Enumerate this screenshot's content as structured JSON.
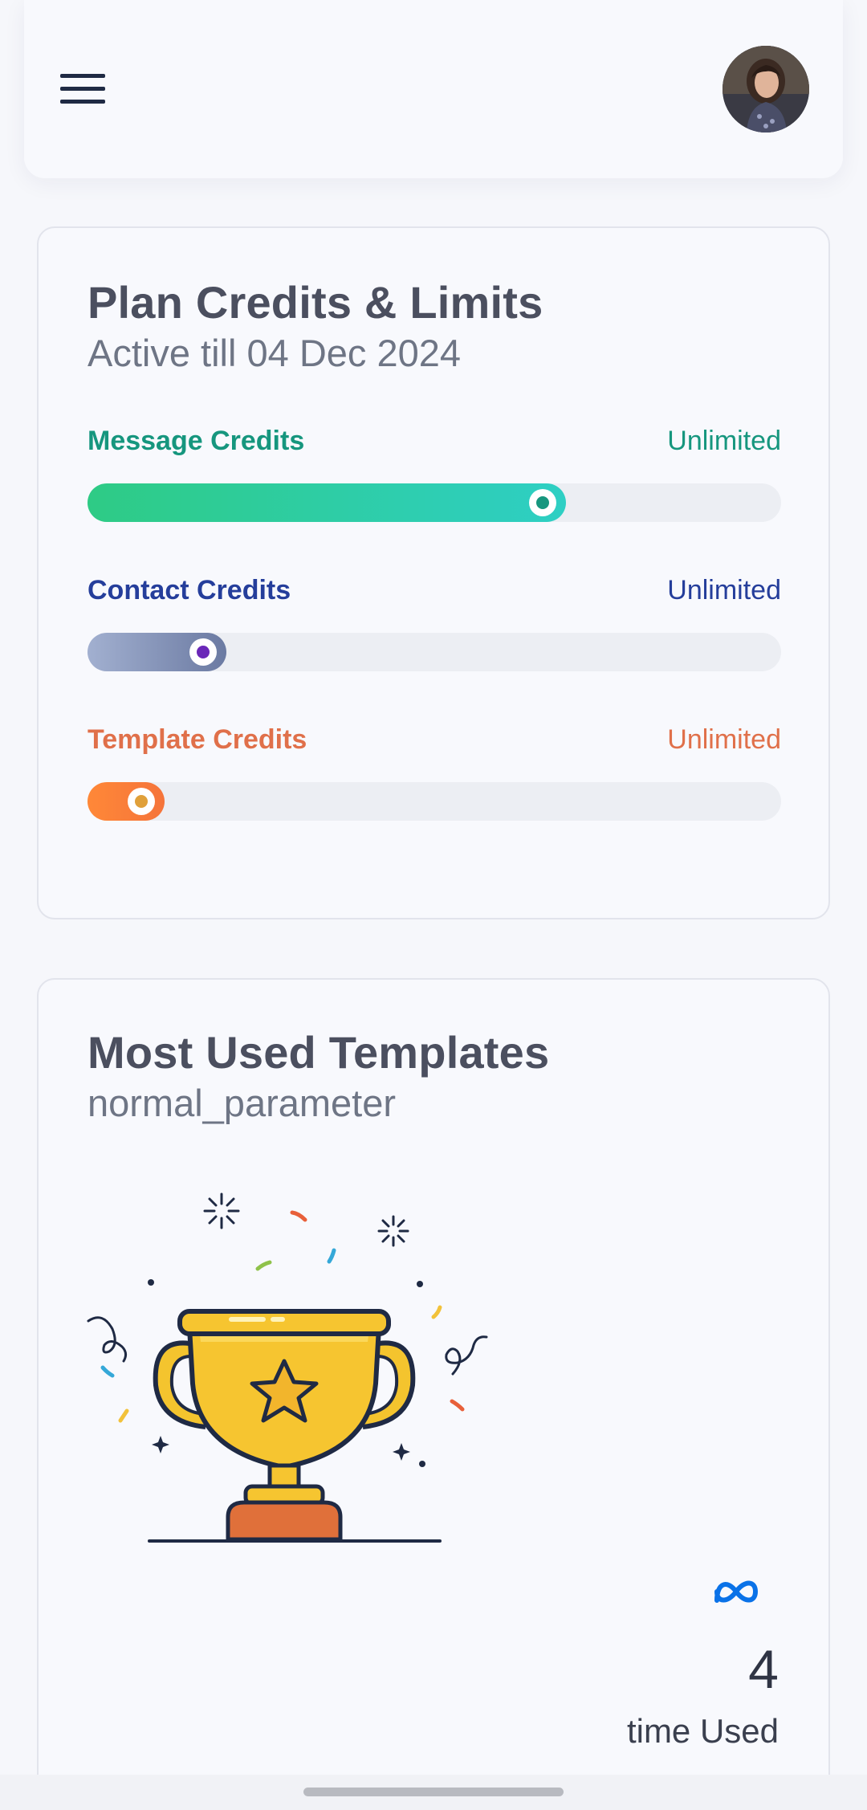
{
  "header": {
    "menu_icon": "hamburger-icon",
    "avatar_icon": "user-avatar"
  },
  "plan": {
    "title": "Plan Credits & Limits",
    "subtitle": "Active till 04 Dec 2024",
    "credits": [
      {
        "label": "Message Credits",
        "value": "Unlimited",
        "progress": 0.69,
        "color": "#16967e",
        "fill_from": "#2ecb85",
        "fill_to": "#2ecfc4",
        "dot": "#16967e"
      },
      {
        "label": "Contact Credits",
        "value": "Unlimited",
        "progress": 0.2,
        "color": "#253e9b",
        "fill_from": "#a2b0d0",
        "fill_to": "#6b7aa2",
        "dot": "#6a27b8"
      },
      {
        "label": "Template Credits",
        "value": "Unlimited",
        "progress": 0.11,
        "color": "#e0704a",
        "fill_from": "#ff8838",
        "fill_to": "#f5743a",
        "dot": "#e0a03a"
      }
    ]
  },
  "templates": {
    "title": "Most Used Templates",
    "subtitle": "normal_parameter",
    "illustration": "trophy-illustration",
    "platform_icon": "meta-icon",
    "count": "4",
    "count_label": "time Used"
  }
}
